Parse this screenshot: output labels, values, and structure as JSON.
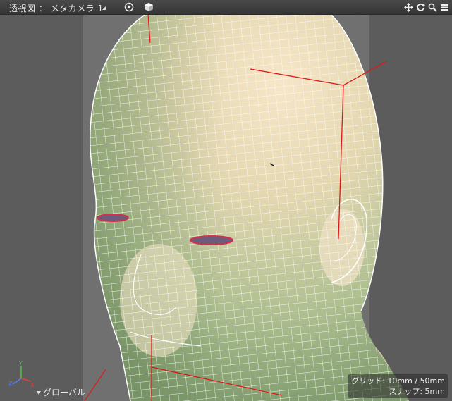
{
  "header": {
    "view_title": "透視図 ： メタカメラ 1",
    "nav_icons": [
      "move-icon",
      "rotate-icon",
      "zoom-icon",
      "menu-icon"
    ]
  },
  "viewport": {
    "grid_info": "グリッド: 10mm / 50mm",
    "snap_info": "スナップ: 5mm",
    "coord_system": "グローバル",
    "axes": {
      "x": "X",
      "y": "Y",
      "z": "Z"
    }
  },
  "colors": {
    "background": "#5c5c5c",
    "frame": "#707070",
    "wire": "#ffffff",
    "guide": "#e01818"
  }
}
